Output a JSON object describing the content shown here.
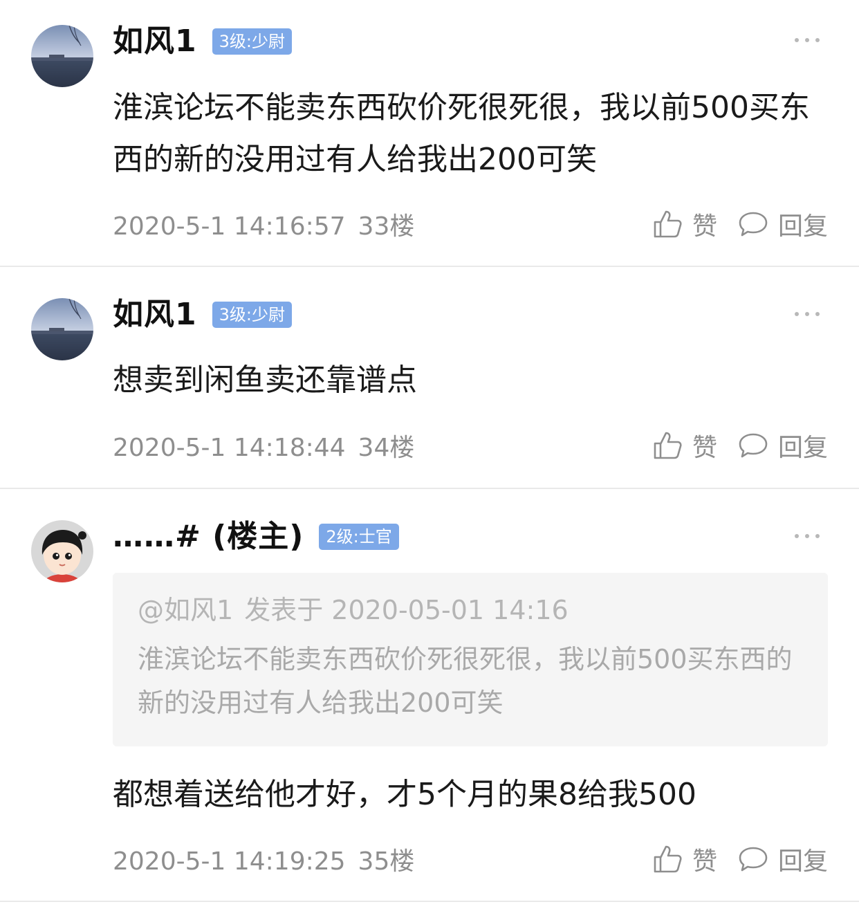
{
  "posts": [
    {
      "username": "如风1",
      "badge": "3级:少尉",
      "content": "淮滨论坛不能卖东西砍价死很死很，我以前500买东西的新的没用过有人给我出200可笑",
      "time": "2020-5-1 14:16:57",
      "floor": "33楼",
      "like_label": "赞",
      "reply_label": "回复"
    },
    {
      "username": "如风1",
      "badge": "3级:少尉",
      "content": "想卖到闲鱼卖还靠谱点",
      "time": "2020-5-1 14:18:44",
      "floor": "34楼",
      "like_label": "赞",
      "reply_label": "回复"
    },
    {
      "username": "……# (楼主)",
      "badge": "2级:士官",
      "quote_author": "@如风1",
      "quote_time": "发表于 2020-05-01 14:16",
      "quote_text": "淮滨论坛不能卖东西砍价死很死很，我以前500买东西的新的没用过有人给我出200可笑",
      "content": "都想着送给他才好，才5个月的果8给我500",
      "time": "2020-5-1 14:19:25",
      "floor": "35楼",
      "like_label": "赞",
      "reply_label": "回复"
    }
  ],
  "colors": {
    "badge": "#7da8e8",
    "meta_text": "#8e8e8e",
    "quote_bg": "#f5f5f5",
    "divider": "#e9e9e9"
  },
  "icons": [
    "lake-avatar",
    "cartoon-girl-avatar",
    "more-dots-icon",
    "thumbs-up-icon",
    "comment-bubble-icon"
  ]
}
